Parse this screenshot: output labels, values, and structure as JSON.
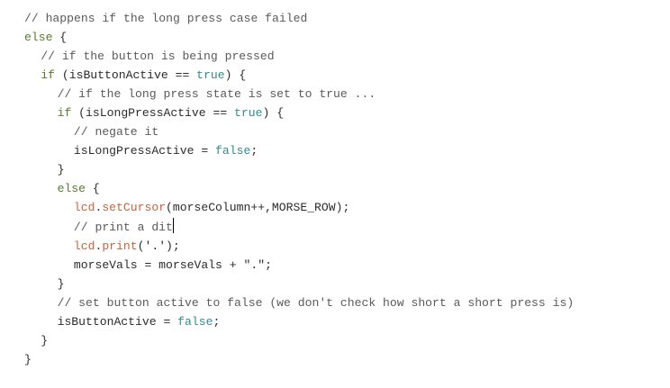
{
  "editor": {
    "lines": [
      {
        "indent": 0,
        "tokens": [
          {
            "type": "comment",
            "text": "// happens if the long press case failed"
          }
        ]
      },
      {
        "indent": 0,
        "tokens": [
          {
            "type": "keyword",
            "text": "else"
          },
          {
            "type": "plain",
            "text": " {"
          }
        ]
      },
      {
        "indent": 1,
        "tokens": [
          {
            "type": "comment",
            "text": "// if the button is being pressed"
          }
        ]
      },
      {
        "indent": 1,
        "tokens": [
          {
            "type": "keyword",
            "text": "if"
          },
          {
            "type": "plain",
            "text": " (isButtonActive == "
          },
          {
            "type": "literal",
            "text": "true"
          },
          {
            "type": "plain",
            "text": ") {"
          }
        ]
      },
      {
        "indent": 2,
        "tokens": [
          {
            "type": "comment",
            "text": "// if the long press state is set to true ..."
          }
        ]
      },
      {
        "indent": 2,
        "tokens": [
          {
            "type": "keyword",
            "text": "if"
          },
          {
            "type": "plain",
            "text": " (isLongPressActive == "
          },
          {
            "type": "literal",
            "text": "true"
          },
          {
            "type": "plain",
            "text": ") {"
          }
        ]
      },
      {
        "indent": 3,
        "tokens": [
          {
            "type": "comment",
            "text": "// negate it"
          }
        ]
      },
      {
        "indent": 3,
        "tokens": [
          {
            "type": "plain",
            "text": "isLongPressActive = "
          },
          {
            "type": "literal",
            "text": "false"
          },
          {
            "type": "plain",
            "text": ";"
          }
        ]
      },
      {
        "indent": 2,
        "tokens": [
          {
            "type": "plain",
            "text": "}"
          }
        ]
      },
      {
        "indent": 2,
        "tokens": [
          {
            "type": "keyword",
            "text": "else"
          },
          {
            "type": "plain",
            "text": " {"
          }
        ]
      },
      {
        "indent": 3,
        "tokens": [
          {
            "type": "object",
            "text": "lcd"
          },
          {
            "type": "plain",
            "text": "."
          },
          {
            "type": "method",
            "text": "setCursor"
          },
          {
            "type": "plain",
            "text": "(morseColumn++,MORSE_ROW);"
          }
        ]
      },
      {
        "indent": 3,
        "tokens": [
          {
            "type": "comment",
            "text": "// print a dit"
          }
        ],
        "caret": true
      },
      {
        "indent": 3,
        "tokens": [
          {
            "type": "object",
            "text": "lcd"
          },
          {
            "type": "plain",
            "text": "."
          },
          {
            "type": "method",
            "text": "print"
          },
          {
            "type": "plain",
            "text": "('.');"
          }
        ]
      },
      {
        "indent": 3,
        "tokens": [
          {
            "type": "plain",
            "text": "morseVals = morseVals + "
          },
          {
            "type": "string",
            "text": "\".\""
          },
          {
            "type": "plain",
            "text": ";"
          }
        ]
      },
      {
        "indent": 2,
        "tokens": [
          {
            "type": "plain",
            "text": "}"
          }
        ]
      },
      {
        "indent": 2,
        "tokens": [
          {
            "type": "comment",
            "text": "// set button active to false (we don't check how short a short press is)"
          }
        ]
      },
      {
        "indent": 2,
        "tokens": [
          {
            "type": "plain",
            "text": "isButtonActive = "
          },
          {
            "type": "literal",
            "text": "false"
          },
          {
            "type": "plain",
            "text": ";"
          }
        ]
      },
      {
        "indent": 1,
        "tokens": [
          {
            "type": "plain",
            "text": "}"
          }
        ]
      },
      {
        "indent": 0,
        "tokens": [
          {
            "type": "plain",
            "text": "}"
          }
        ]
      }
    ]
  },
  "colors": {
    "background": "#ffffff",
    "comment": "#5a5a5a",
    "keyword": "#587a2c",
    "literal": "#2f8d8b",
    "method": "#c8633a",
    "plain": "#2b2b2b",
    "caret": "#000000"
  }
}
